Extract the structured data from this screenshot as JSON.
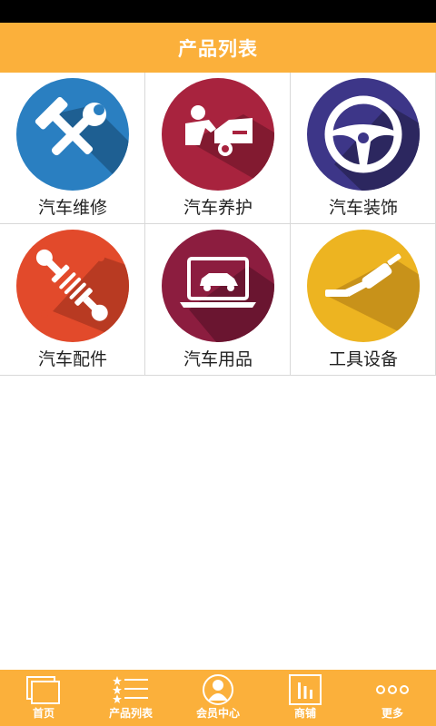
{
  "header": {
    "title": "产品列表"
  },
  "grid": {
    "items": [
      {
        "label": "汽车维修",
        "icon": "wrench-hammer-icon",
        "color": "#2A7FC1"
      },
      {
        "label": "汽车养护",
        "icon": "car-mechanic-icon",
        "color": "#A8233E"
      },
      {
        "label": "汽车装饰",
        "icon": "steering-wheel-icon",
        "color": "#3D3688"
      },
      {
        "label": "汽车配件",
        "icon": "shock-absorber-icon",
        "color": "#E24A2B"
      },
      {
        "label": "汽车用品",
        "icon": "laptop-car-icon",
        "color": "#8C1D3F"
      },
      {
        "label": "工具设备",
        "icon": "exhaust-pipe-icon",
        "color": "#EDB421"
      }
    ]
  },
  "tabbar": {
    "items": [
      {
        "label": "首页",
        "icon": "home-icon"
      },
      {
        "label": "产品列表",
        "icon": "list-icon"
      },
      {
        "label": "会员中心",
        "icon": "member-icon"
      },
      {
        "label": "商铺",
        "icon": "shop-icon"
      },
      {
        "label": "更多",
        "icon": "more-icon"
      }
    ]
  },
  "colors": {
    "accent": "#FBB03B",
    "status_bar": "#000000"
  }
}
